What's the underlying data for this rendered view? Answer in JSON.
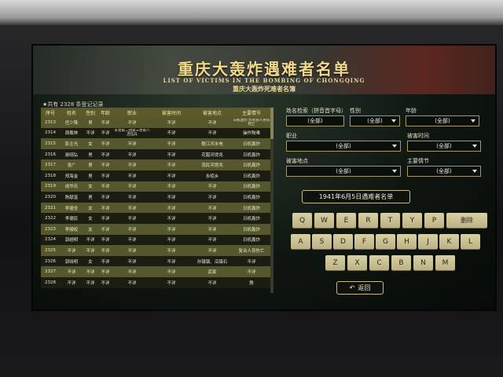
{
  "header": {
    "title_cn": "重庆大轰炸遇难者名单",
    "title_en": "LIST OF VICTIMS IN THE BOMBING OF CHONGQING",
    "subtitle": "重庆大轰炸死难者名簿"
  },
  "table": {
    "count_text": "★共有 2328 条登记记录",
    "headers": [
      "序号",
      "姓名",
      "性别",
      "年龄",
      "职业",
      "被害时间",
      "被害地点",
      "主要情节"
    ],
    "rows": [
      [
        "2313",
        "任少降",
        "男",
        "不详",
        "不详",
        "不详",
        "不详",
        "日机轰炸 炸死多人另伤死亡"
      ],
      [
        "2314",
        "周载林",
        "不详",
        "不详",
        "军营第二团第三营第八连伍兵",
        "不详",
        "不详",
        "操作殉难"
      ],
      [
        "2315",
        "彭主光",
        "女",
        "不详",
        "不详",
        "不详",
        "歌江河水电",
        "日机轰炸"
      ],
      [
        "2316",
        "谢翊弘",
        "男",
        "不详",
        "不详",
        "不详",
        "花腊河堤兆",
        "日机轰炸"
      ],
      [
        "2317",
        "张广",
        "男",
        "不详",
        "不详",
        "不详",
        "流民河堤兆",
        "日机轰炸"
      ],
      [
        "2318",
        "郑海金",
        "男",
        "不详",
        "不详",
        "不详",
        "永昭乡",
        "日机轰炸"
      ],
      [
        "2319",
        "成华氏",
        "女",
        "不详",
        "不详",
        "不详",
        "不详",
        "日机轰炸"
      ],
      [
        "2320",
        "陈献富",
        "男",
        "不详",
        "不详",
        "不详",
        "不详",
        "日机轰炸"
      ],
      [
        "2321",
        "李德全",
        "女",
        "不详",
        "不详",
        "不详",
        "不详",
        "日机轰炸"
      ],
      [
        "2322",
        "李德民",
        "女",
        "不详",
        "不详",
        "不详",
        "不详",
        "日机轰炸"
      ],
      [
        "2323",
        "李顺权",
        "女",
        "不详",
        "不详",
        "不详",
        "不详",
        "日机轰炸"
      ],
      [
        "2324",
        "郭超明",
        "不详",
        "不详",
        "不详",
        "不详",
        "不详",
        "日机轰炸"
      ],
      [
        "2325",
        "不详",
        "不详",
        "不详",
        "不详",
        "不详",
        "不详",
        "复合人员伤亡"
      ],
      [
        "2326",
        "郭晓明",
        "女",
        "不详",
        "不详",
        "不详",
        "孙镇镇、沿镇石",
        "不详"
      ],
      [
        "2327",
        "不详",
        "不详",
        "不详",
        "不详",
        "不详",
        "武家",
        "不详"
      ],
      [
        "2328",
        "不详",
        "不详",
        "不详",
        "不详",
        "不详",
        "不详",
        "殷"
      ]
    ]
  },
  "filters": {
    "name_label": "姓名检索（拼音首字母）",
    "name_value": "(全部)",
    "gender_label": "性别",
    "gender_value": "(全部)",
    "age_label": "年龄",
    "age_value": "(全部)",
    "job_label": "职业",
    "job_value": "(全部)",
    "time_label": "被害时间",
    "time_value": "(全部)",
    "place_label": "被害地点",
    "place_value": "(全部)",
    "plot_label": "主要情节",
    "plot_value": "(全部)"
  },
  "date_button": "1941年6月5日遇难者名单",
  "keyboard": {
    "row1": [
      "Q",
      "W",
      "E",
      "R",
      "T",
      "Y",
      "P"
    ],
    "delete": "删除",
    "row2": [
      "A",
      "S",
      "D",
      "F",
      "G",
      "H",
      "J",
      "K",
      "L"
    ],
    "row3": [
      "Z",
      "X",
      "C",
      "B",
      "N",
      "M"
    ]
  },
  "back_label": "返回"
}
